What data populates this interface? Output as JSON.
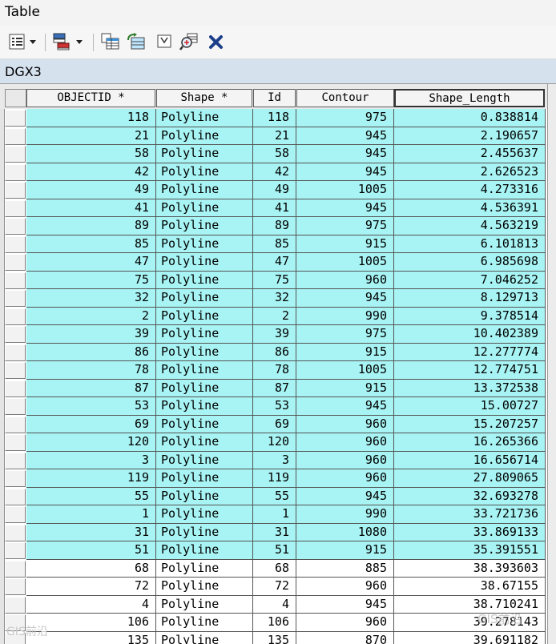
{
  "window": {
    "title": "Table"
  },
  "toolbar": {
    "icons": [
      "table-options-icon",
      "related-tables-icon",
      "select-by-attributes-icon",
      "switch-selection-icon",
      "clear-selection-icon",
      "zoom-to-selected-icon",
      "delete-selected-icon"
    ]
  },
  "table": {
    "name": "DGX3",
    "columns": [
      "OBJECTID *",
      "Shape *",
      "Id",
      "Contour",
      "Shape_Length"
    ],
    "rows": [
      {
        "objectid": "118",
        "shape": "Polyline",
        "id": "118",
        "contour": "975",
        "length": "0.838814",
        "selected": true
      },
      {
        "objectid": "21",
        "shape": "Polyline",
        "id": "21",
        "contour": "945",
        "length": "2.190657",
        "selected": true
      },
      {
        "objectid": "58",
        "shape": "Polyline",
        "id": "58",
        "contour": "945",
        "length": "2.455637",
        "selected": true
      },
      {
        "objectid": "42",
        "shape": "Polyline",
        "id": "42",
        "contour": "945",
        "length": "2.626523",
        "selected": true
      },
      {
        "objectid": "49",
        "shape": "Polyline",
        "id": "49",
        "contour": "1005",
        "length": "4.273316",
        "selected": true
      },
      {
        "objectid": "41",
        "shape": "Polyline",
        "id": "41",
        "contour": "945",
        "length": "4.536391",
        "selected": true
      },
      {
        "objectid": "89",
        "shape": "Polyline",
        "id": "89",
        "contour": "975",
        "length": "4.563219",
        "selected": true
      },
      {
        "objectid": "85",
        "shape": "Polyline",
        "id": "85",
        "contour": "915",
        "length": "6.101813",
        "selected": true
      },
      {
        "objectid": "47",
        "shape": "Polyline",
        "id": "47",
        "contour": "1005",
        "length": "6.985698",
        "selected": true
      },
      {
        "objectid": "75",
        "shape": "Polyline",
        "id": "75",
        "contour": "960",
        "length": "7.046252",
        "selected": true
      },
      {
        "objectid": "32",
        "shape": "Polyline",
        "id": "32",
        "contour": "945",
        "length": "8.129713",
        "selected": true
      },
      {
        "objectid": "2",
        "shape": "Polyline",
        "id": "2",
        "contour": "990",
        "length": "9.378514",
        "selected": true
      },
      {
        "objectid": "39",
        "shape": "Polyline",
        "id": "39",
        "contour": "975",
        "length": "10.402389",
        "selected": true
      },
      {
        "objectid": "86",
        "shape": "Polyline",
        "id": "86",
        "contour": "915",
        "length": "12.277774",
        "selected": true
      },
      {
        "objectid": "78",
        "shape": "Polyline",
        "id": "78",
        "contour": "1005",
        "length": "12.774751",
        "selected": true
      },
      {
        "objectid": "87",
        "shape": "Polyline",
        "id": "87",
        "contour": "915",
        "length": "13.372538",
        "selected": true
      },
      {
        "objectid": "53",
        "shape": "Polyline",
        "id": "53",
        "contour": "945",
        "length": "15.00727",
        "selected": true
      },
      {
        "objectid": "69",
        "shape": "Polyline",
        "id": "69",
        "contour": "960",
        "length": "15.207257",
        "selected": true
      },
      {
        "objectid": "120",
        "shape": "Polyline",
        "id": "120",
        "contour": "960",
        "length": "16.265366",
        "selected": true
      },
      {
        "objectid": "3",
        "shape": "Polyline",
        "id": "3",
        "contour": "960",
        "length": "16.656714",
        "selected": true
      },
      {
        "objectid": "119",
        "shape": "Polyline",
        "id": "119",
        "contour": "960",
        "length": "27.809065",
        "selected": true
      },
      {
        "objectid": "55",
        "shape": "Polyline",
        "id": "55",
        "contour": "945",
        "length": "32.693278",
        "selected": true
      },
      {
        "objectid": "1",
        "shape": "Polyline",
        "id": "1",
        "contour": "990",
        "length": "33.721736",
        "selected": true
      },
      {
        "objectid": "31",
        "shape": "Polyline",
        "id": "31",
        "contour": "1080",
        "length": "33.869133",
        "selected": true
      },
      {
        "objectid": "51",
        "shape": "Polyline",
        "id": "51",
        "contour": "915",
        "length": "35.391551",
        "selected": true
      },
      {
        "objectid": "68",
        "shape": "Polyline",
        "id": "68",
        "contour": "885",
        "length": "38.393603",
        "selected": false
      },
      {
        "objectid": "72",
        "shape": "Polyline",
        "id": "72",
        "contour": "960",
        "length": "38.67155",
        "selected": false
      },
      {
        "objectid": "4",
        "shape": "Polyline",
        "id": "4",
        "contour": "945",
        "length": "38.710241",
        "selected": false
      },
      {
        "objectid": "106",
        "shape": "Polyline",
        "id": "106",
        "contour": "960",
        "length": "39.278143",
        "selected": false
      },
      {
        "objectid": "135",
        "shape": "Polyline",
        "id": "135",
        "contour": "870",
        "length": "39.691182",
        "selected": false
      }
    ]
  },
  "colors": {
    "selected_row": "#a8f3f3",
    "header_bg": "#f4f4f4",
    "tab_header_bg": "#d6e1ee"
  },
  "watermark": {
    "left": "GIS前沿",
    "right": "GIS前沿"
  }
}
